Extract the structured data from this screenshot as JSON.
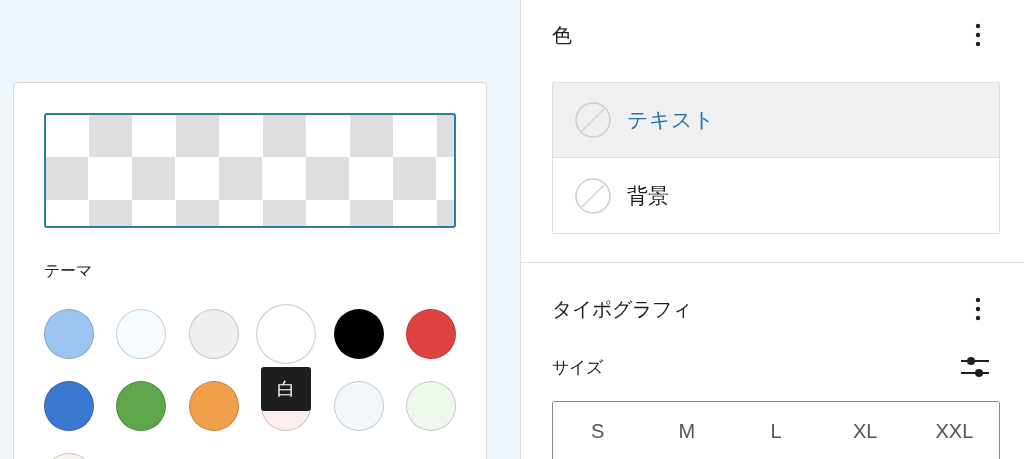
{
  "color_picker": {
    "theme_label": "テーマ",
    "swatches": [
      {
        "color": "#9dc5f2",
        "hovered": false
      },
      {
        "color": "#f5fbff",
        "hovered": false
      },
      {
        "color": "#efefef",
        "hovered": false
      },
      {
        "color": "#ffffff",
        "hovered": true
      },
      {
        "color": "#000000",
        "hovered": false
      },
      {
        "color": "#e04141",
        "hovered": false
      },
      {
        "color": "#3b78d2",
        "hovered": false
      },
      {
        "color": "#5ea64a",
        "hovered": false
      },
      {
        "color": "#f0a04a",
        "hovered": false
      },
      {
        "color": "#fdeeee",
        "hovered": false
      },
      {
        "color": "#f2f7fc",
        "hovered": false
      },
      {
        "color": "#eef8ec",
        "hovered": false
      },
      {
        "color": "#f6f4ea",
        "hovered": false
      }
    ],
    "tooltip": "白"
  },
  "sidebar": {
    "color_section": {
      "title": "色",
      "items": [
        {
          "label": "テキスト",
          "selected": true
        },
        {
          "label": "背景",
          "selected": false
        }
      ]
    },
    "typography_section": {
      "title": "タイポグラフィ",
      "size_label": "サイズ",
      "sizes": [
        {
          "label": "S",
          "selected": false
        },
        {
          "label": "M",
          "selected": false
        },
        {
          "label": "L",
          "selected": false
        },
        {
          "label": "XL",
          "selected": false
        },
        {
          "label": "XXL",
          "selected": false
        }
      ]
    }
  }
}
